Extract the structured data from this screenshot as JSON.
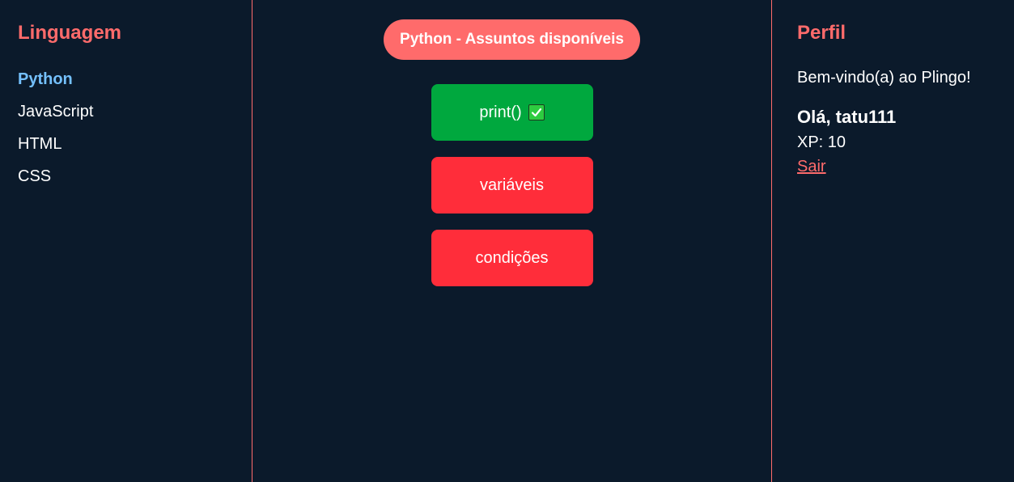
{
  "sidebar": {
    "title": "Linguagem",
    "languages": [
      {
        "label": "Python",
        "active": true
      },
      {
        "label": "JavaScript",
        "active": false
      },
      {
        "label": "HTML",
        "active": false
      },
      {
        "label": "CSS",
        "active": false
      }
    ]
  },
  "main": {
    "heading": "Python - Assuntos disponíveis",
    "topics": [
      {
        "label": "print()",
        "completed": true,
        "color": "#00a83e",
        "icon": "check-box-icon"
      },
      {
        "label": "variáveis",
        "completed": false,
        "color": "#ff2d3a"
      },
      {
        "label": "condições",
        "completed": false,
        "color": "#ff2d3a"
      }
    ]
  },
  "profile": {
    "title": "Perfil",
    "welcome": "Bem-vindo(a) ao Plingo!",
    "greeting": "Olá, tatu111",
    "xp": "XP: 10",
    "logout": "Sair"
  },
  "colors": {
    "background": "#0b1a2b",
    "accent": "#ff6b6b",
    "active_link": "#74c0fc",
    "completed": "#00a83e",
    "pending": "#ff2d3a"
  }
}
